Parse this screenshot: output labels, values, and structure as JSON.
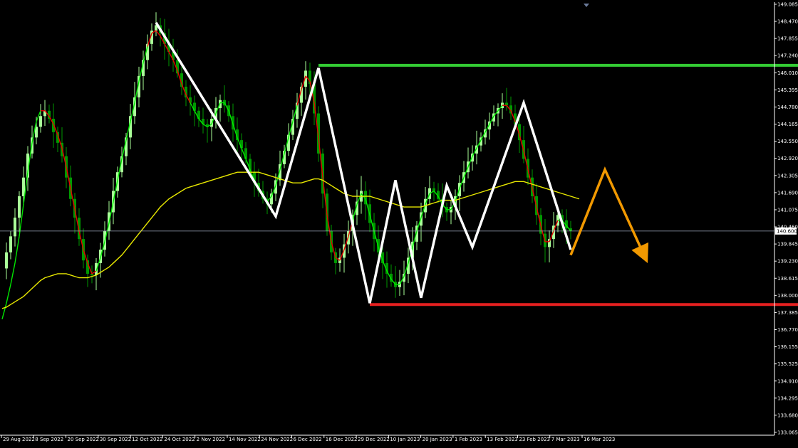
{
  "chart_data": {
    "type": "candlestick",
    "grid": false,
    "background": "#000000",
    "ylim": [
      133.065,
      149.085
    ],
    "y_ticks": [
      "149.085",
      "148.470",
      "147.855",
      "147.240",
      "146.010",
      "145.395",
      "144.780",
      "144.165",
      "143.550",
      "142.920",
      "142.305",
      "141.690",
      "141.075",
      "140.460",
      "139.845",
      "139.230",
      "138.615",
      "138.000",
      "137.385",
      "136.770",
      "136.155",
      "135.525",
      "134.910",
      "134.295",
      "133.680",
      "133.065"
    ],
    "x_ticks": [
      "29 Aug 2022",
      "8 Sep 2022",
      "20 Sep 2022",
      "30 Sep 2022",
      "12 Oct 2022",
      "24 Oct 2022",
      "2 Nov 2022",
      "14 Nov 2022",
      "24 Nov 2022",
      "6 Dec 2022",
      "16 Dec 2022",
      "29 Dec 2022",
      "10 Jan 2023",
      "20 Jan 2023",
      "1 Feb 2023",
      "13 Feb 2023",
      "23 Feb 2023",
      "7 Mar 2023",
      "16 Mar 2023"
    ],
    "current_price": "140.600",
    "current_price_value": 140.6,
    "resistance_level": 146.8,
    "support_level": 137.85,
    "price_path": [
      139.2,
      139.8,
      140.4,
      141.1,
      141.9,
      142.6,
      143.5,
      144.1,
      144.5,
      144.9,
      145.1,
      144.8,
      144.3,
      143.9,
      143.4,
      142.6,
      141.8,
      141.1,
      140.3,
      139.5,
      139.0,
      138.95,
      139.4,
      139.9,
      140.6,
      141.3,
      142.1,
      142.8,
      143.4,
      144.1,
      144.9,
      145.6,
      146.4,
      147.0,
      147.6,
      148.1,
      148.3,
      148.0,
      147.6,
      147.3,
      147.0,
      146.5,
      146.0,
      145.6,
      145.4,
      145.1,
      144.8,
      144.6,
      144.5,
      144.8,
      145.2,
      145.5,
      145.3,
      144.9,
      144.4,
      144.0,
      143.7,
      143.3,
      142.8,
      142.4,
      142.1,
      141.8,
      141.6,
      142.0,
      142.5,
      143.1,
      143.6,
      144.2,
      144.8,
      145.4,
      146.0,
      146.6,
      146.1,
      145.0,
      143.5,
      142.0,
      140.6,
      139.8,
      139.4,
      139.6,
      140.1,
      140.6,
      141.2,
      141.7,
      142.1,
      141.6,
      140.9,
      140.3,
      139.8,
      139.4,
      139.0,
      138.7,
      138.5,
      138.7,
      139.0,
      139.6,
      140.2,
      140.8,
      141.3,
      141.8,
      142.2,
      142.1,
      141.8,
      141.5,
      141.3,
      141.5,
      141.9,
      142.4,
      142.8,
      143.2,
      143.5,
      143.8,
      144.1,
      144.4,
      144.7,
      145.0,
      145.2,
      145.4,
      145.3,
      145.0,
      144.6,
      144.0,
      143.3,
      142.6,
      141.9,
      141.2,
      140.5,
      140.0,
      140.3,
      140.8,
      141.2,
      141.0,
      140.7,
      140.6
    ],
    "series": [
      {
        "name": "",
        "color": "#00e600",
        "values": [
          137.3,
          137.9,
          138.6,
          139.4,
          140.4,
          141.6,
          142.8,
          143.9,
          144.7,
          145.1,
          145.1,
          144.9,
          144.6,
          144.2,
          143.7,
          143.0,
          142.2,
          141.4,
          140.6,
          139.9,
          139.4,
          139.0,
          139.1,
          139.6,
          140.2,
          140.9,
          141.7,
          142.5,
          143.3,
          144.0,
          144.7,
          145.4,
          146.2,
          146.9,
          147.5,
          148.0,
          148.1,
          147.9,
          147.6,
          147.3,
          147.0,
          146.6,
          146.1,
          145.7,
          145.4,
          145.1,
          144.8,
          144.6,
          144.5,
          144.6,
          145.0,
          145.4,
          145.4,
          145.1,
          144.6,
          144.1,
          143.7,
          143.3,
          142.9,
          142.5,
          142.2,
          141.9,
          141.7,
          141.9,
          142.3,
          142.9,
          143.5,
          144.1,
          144.7,
          145.3,
          145.9,
          146.4,
          146.2,
          145.4,
          144.1,
          142.6,
          141.2,
          140.2,
          139.6,
          139.5,
          139.9,
          140.4,
          141.0,
          141.6,
          142.0,
          141.8,
          141.2,
          140.6,
          140.0,
          139.5,
          139.1,
          138.8,
          138.6,
          138.6,
          138.9,
          139.4,
          140.0,
          140.6,
          141.1,
          141.6,
          142.0,
          142.1,
          141.9,
          141.6,
          141.4,
          141.4,
          141.7,
          142.2,
          142.6,
          143.0,
          143.4,
          143.7,
          144.0,
          144.3,
          144.6,
          144.9,
          145.1,
          145.3,
          145.3,
          145.1,
          144.7,
          144.2,
          143.6,
          142.9,
          142.2,
          141.5,
          140.8,
          140.2,
          140.2,
          140.6,
          141.0,
          141.0,
          140.8,
          140.6
        ]
      },
      {
        "name": "",
        "color": "#e8e800",
        "values": [
          137.7,
          137.75,
          137.85,
          137.95,
          138.05,
          138.15,
          138.3,
          138.45,
          138.6,
          138.75,
          138.85,
          138.9,
          138.95,
          139.0,
          139.0,
          139.0,
          138.95,
          138.9,
          138.85,
          138.85,
          138.85,
          138.9,
          138.95,
          139.05,
          139.15,
          139.25,
          139.4,
          139.55,
          139.7,
          139.9,
          140.1,
          140.3,
          140.5,
          140.7,
          140.9,
          141.1,
          141.3,
          141.5,
          141.65,
          141.8,
          141.9,
          142.0,
          142.1,
          142.2,
          142.25,
          142.3,
          142.35,
          142.4,
          142.45,
          142.5,
          142.55,
          142.6,
          142.65,
          142.7,
          142.75,
          142.8,
          142.8,
          142.8,
          142.8,
          142.8,
          142.8,
          142.75,
          142.7,
          142.65,
          142.6,
          142.55,
          142.5,
          142.45,
          142.4,
          142.4,
          142.4,
          142.45,
          142.5,
          142.55,
          142.55,
          142.5,
          142.4,
          142.3,
          142.2,
          142.1,
          142.0,
          141.95,
          141.9,
          141.9,
          141.9,
          141.9,
          141.9,
          141.85,
          141.8,
          141.75,
          141.7,
          141.65,
          141.6,
          141.55,
          141.5,
          141.5,
          141.5,
          141.5,
          141.5,
          141.55,
          141.6,
          141.65,
          141.7,
          141.75,
          141.75,
          141.75,
          141.75,
          141.8,
          141.85,
          141.9,
          141.95,
          142.0,
          142.05,
          142.1,
          142.15,
          142.2,
          142.25,
          142.3,
          142.35,
          142.4,
          142.45,
          142.45,
          142.45,
          142.4,
          142.35,
          142.3,
          142.25,
          142.2,
          142.15,
          142.1,
          142.05,
          142.0,
          141.95,
          141.9,
          141.85,
          141.8
        ]
      }
    ],
    "red_segments": [
      [
        9,
        22
      ],
      [
        34,
        44
      ],
      [
        69,
        82
      ],
      [
        117,
        130
      ]
    ],
    "zigzag": [
      {
        "i": 36,
        "p": 148.4
      },
      {
        "i": 64,
        "p": 141.15
      },
      {
        "i": 74,
        "p": 146.7
      },
      {
        "i": 86,
        "p": 137.9
      },
      {
        "i": 92,
        "p": 142.5
      },
      {
        "i": 98,
        "p": 138.1
      },
      {
        "i": 104,
        "p": 142.3
      },
      {
        "i": 110,
        "p": 140.0
      },
      {
        "i": 122,
        "p": 145.4
      },
      {
        "i": 133,
        "p": 139.9
      }
    ],
    "projection": [
      {
        "i": 133,
        "p": 139.7
      },
      {
        "i": 141,
        "p": 142.9
      },
      {
        "i": 151,
        "p": 139.4
      }
    ],
    "colors": {
      "up": "#aaff99",
      "down": "#009900",
      "ma_fast_up": "#00e600",
      "ma_fast_down": "#e60000",
      "ma_slow": "#e8e800",
      "zigzag": "#ffffff",
      "projection": "#f29900",
      "resistance": "#33cc33",
      "support": "#e62020",
      "price_line": "#9aa4b8",
      "axis": "#ffffff"
    }
  }
}
